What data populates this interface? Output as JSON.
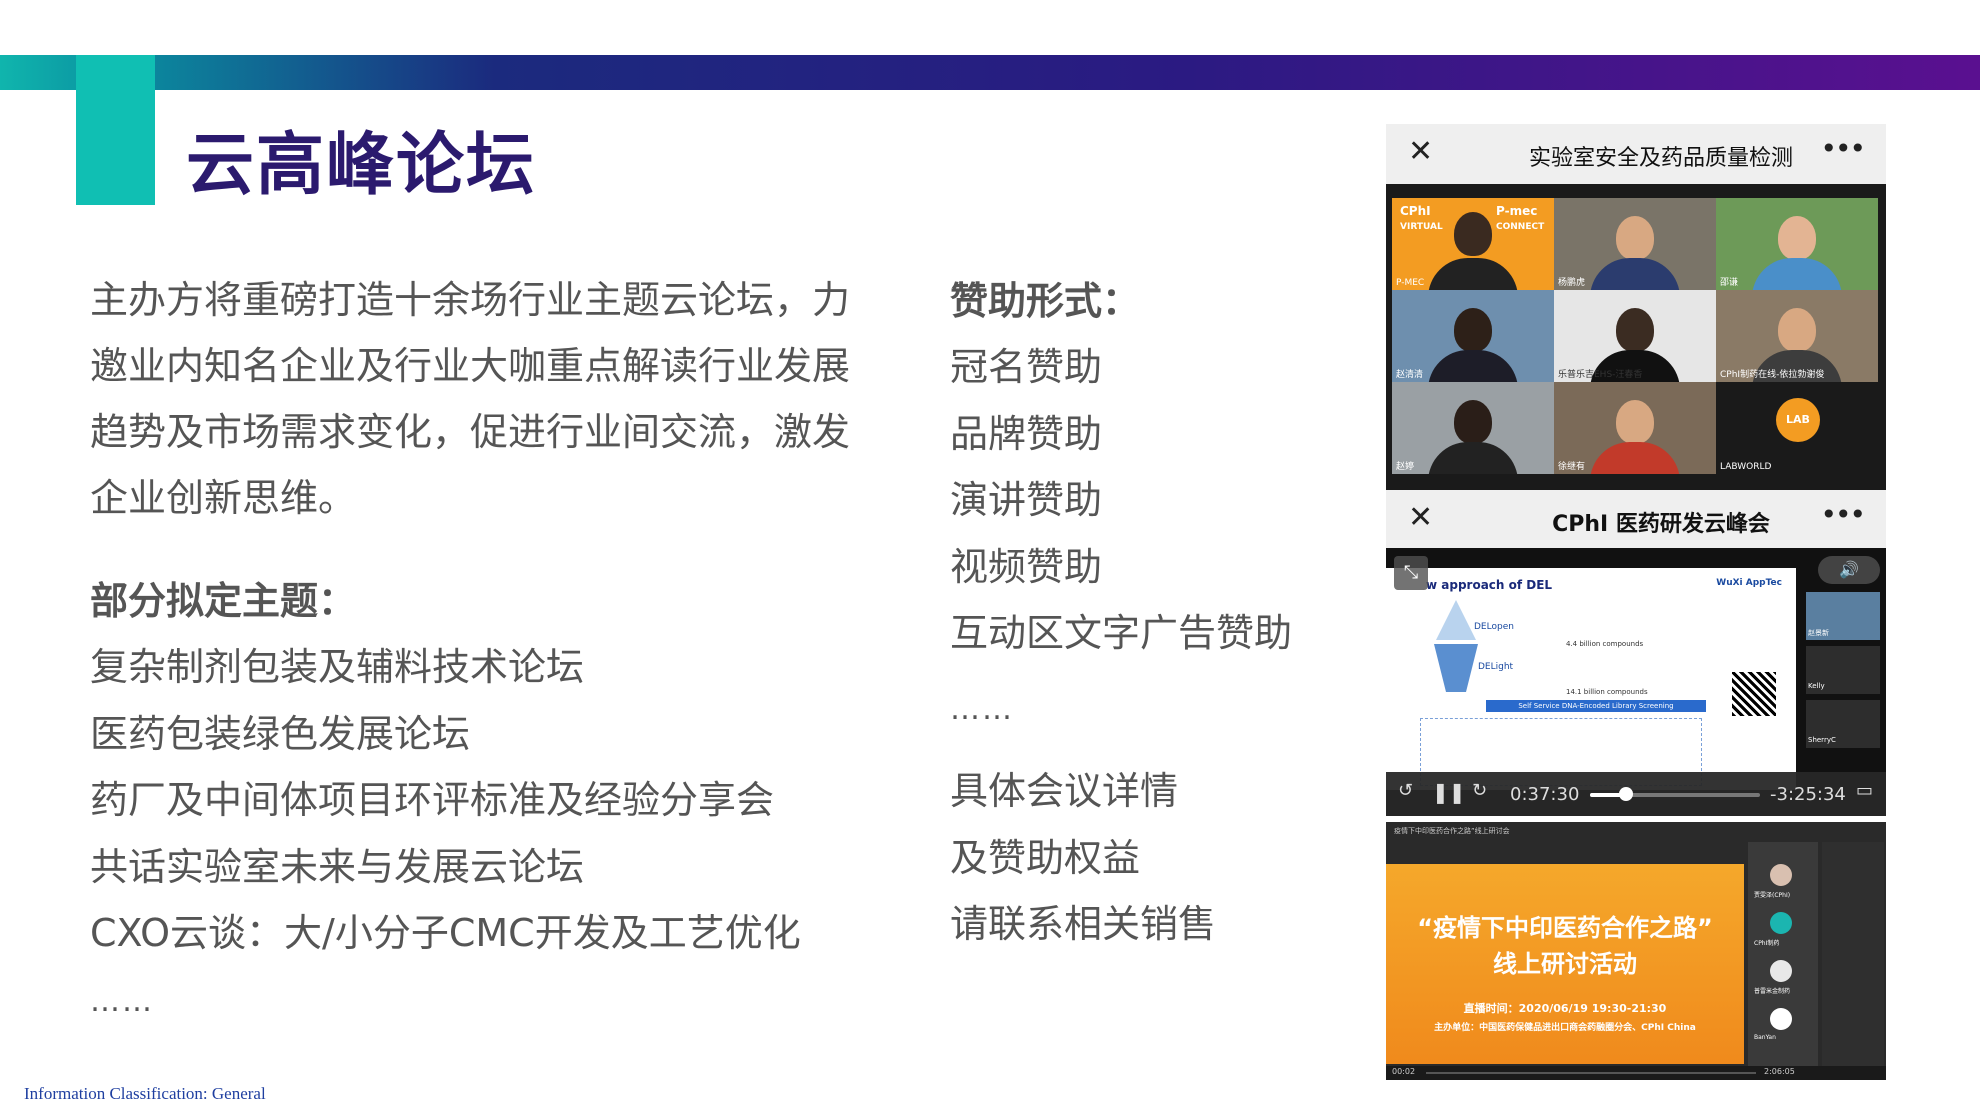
{
  "title": "云高峰论坛",
  "intro": "主办方将重磅打造十余场行业主题云论坛，力邀业内知名企业及行业大咖重点解读行业发展趋势及市场需求变化，促进行业间交流，激发企业创新思维。",
  "themes": {
    "heading": "部分拟定主题：",
    "items": [
      "复杂制剂包装及辅料技术论坛",
      "医药包装绿色发展论坛",
      "药厂及中间体项目环评标准及经验分享会",
      "共话实验室未来与发展云论坛",
      "CXO云谈：大/小分子CMC开发及工艺优化"
    ],
    "more": "……"
  },
  "sponsorship": {
    "heading": "赞助形式：",
    "items": [
      "冠名赞助",
      "品牌赞助",
      "演讲赞助",
      "视频赞助",
      "互动区文字广告赞助"
    ],
    "more": "……"
  },
  "contact": [
    "具体会议详情",
    "及赞助权益",
    "请联系相关销售"
  ],
  "footer": "Information Classification: General",
  "screens": {
    "meeting1": {
      "title": "实验室安全及药品质量检测",
      "close_icon": "close-icon",
      "more_icon": "more-icon",
      "tiles": [
        "P-MEC",
        "杨鹏虎",
        "邵谦",
        "赵清清",
        "乐普乐吉EHS-汪春香",
        "CPhI制药在线-依拉勃谢俊",
        "赵婷",
        "徐继有",
        "LABWORLD"
      ],
      "brand": [
        "CPhI",
        "VIRTUAL",
        "P-mec",
        "CONNECT"
      ],
      "lab_logo": "LAB"
    },
    "meeting2": {
      "title": "CPhI 医药研发云峰会",
      "slide_title": "w approach of DEL",
      "slide_brand": "WuXi AppTec",
      "slide_labels": [
        "DELopen",
        "DELight",
        "Self Service DNA-Encoded Library Screening",
        "4.4 billion compounds",
        "14.1 billion compounds"
      ],
      "side_names": [
        "赵景新",
        "Kelly",
        "SherryC"
      ],
      "elapsed": "0:37:30",
      "remaining": "-3:25:34",
      "progress": 0.21
    },
    "webinar": {
      "title_line1": "“疫情下中印医药合作之路”",
      "title_line2": "线上研讨活动",
      "time": "直播时间：2020/06/19 19:30-21:30",
      "organizer": "主办单位：中国医药保健品进出口商会药融圈分会、CPhI China",
      "header_text": "疫情下中印医药合作之路”线上研讨会",
      "side_names": [
        "贾雯泽(CPhI)",
        "CPhI制药",
        "普雷米金制药",
        "BanYan"
      ],
      "time_left": "00:02",
      "time_right": "2:06:05"
    }
  },
  "colors": {
    "teal": "#10bfb3",
    "title": "#2b1a6e",
    "text": "#555555",
    "footer": "#1f3fa0",
    "orange": "#f39c22"
  }
}
